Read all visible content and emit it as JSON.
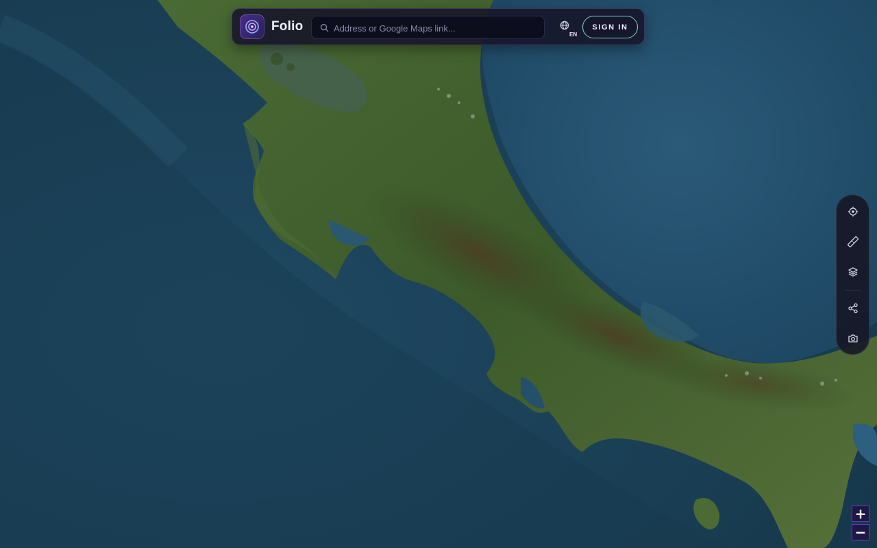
{
  "app": {
    "brand_name": "Folio"
  },
  "search": {
    "placeholder": "Address or Google Maps link..."
  },
  "language": {
    "code": "EN",
    "icon": "globe-icon"
  },
  "auth": {
    "sign_in_label": "SIGN IN"
  },
  "map": {
    "view": "satellite",
    "region": "Central America"
  },
  "toolbar": {
    "tools": [
      {
        "name": "locate",
        "icon": "crosshair-icon"
      },
      {
        "name": "measure",
        "icon": "ruler-icon"
      },
      {
        "name": "layers",
        "icon": "layers-icon"
      },
      {
        "name": "share",
        "icon": "share-icon"
      },
      {
        "name": "screenshot",
        "icon": "camera-icon"
      }
    ]
  },
  "zoom": {
    "in_label": "+",
    "out_label": "−"
  },
  "colors": {
    "accent": "#7fd3d6",
    "panel": "#161428",
    "zoom_button": "#1f1746",
    "ocean": "#1c3f54",
    "land": "#3c5a2c"
  }
}
